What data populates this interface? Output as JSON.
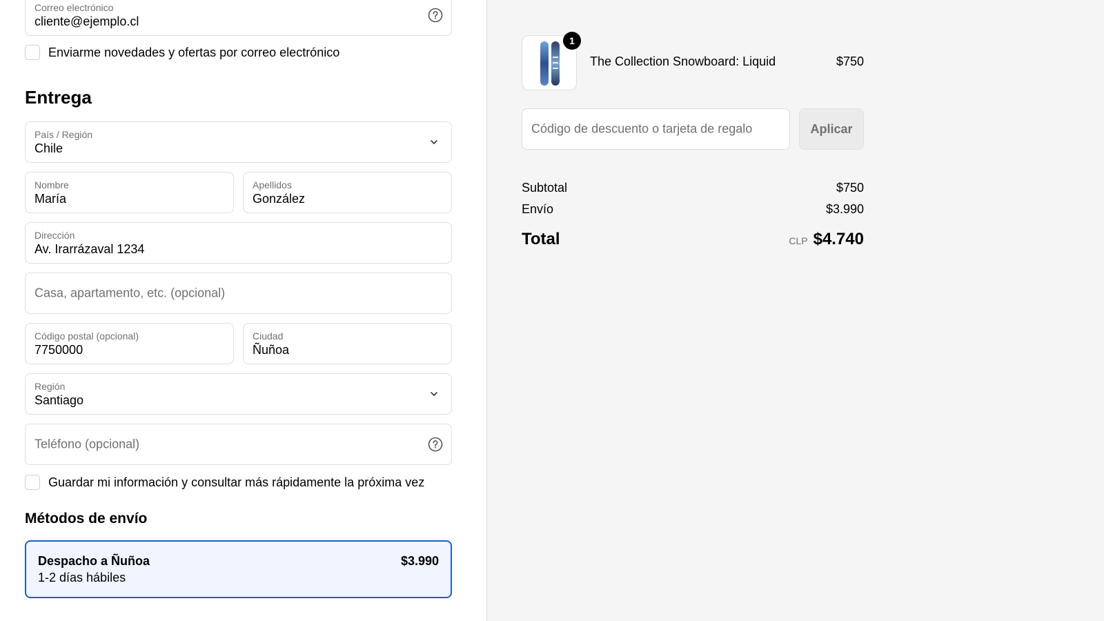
{
  "contact": {
    "email_label": "Correo electrónico",
    "email_value": "cliente@ejemplo.cl",
    "newsletter_label": "Enviarme novedades y ofertas por correo electrónico"
  },
  "delivery": {
    "heading": "Entrega",
    "country_label": "País / Región",
    "country_value": "Chile",
    "first_name_label": "Nombre",
    "first_name_value": "María",
    "last_name_label": "Apellidos",
    "last_name_value": "González",
    "address_label": "Dirección",
    "address_value": "Av. Irarrázaval 1234",
    "apartment_placeholder": "Casa, apartamento, etc. (opcional)",
    "postal_label": "Código postal (opcional)",
    "postal_value": "7750000",
    "city_label": "Ciudad",
    "city_value": "Ñuñoa",
    "region_label": "Región",
    "region_value": "Santiago",
    "phone_placeholder": "Teléfono (opcional)",
    "save_info_label": "Guardar mi información y consultar más rápidamente la próxima vez"
  },
  "shipping": {
    "heading": "Métodos de envío",
    "option_name": "Despacho a Ñuñoa",
    "option_eta": "1-2 días hábiles",
    "option_price": "$3.990",
    "selected_border_color": "#1a5fc8"
  },
  "summary": {
    "item": {
      "quantity_badge": "1",
      "name": "The Collection Snowboard: Liquid",
      "price": "$750",
      "icon": "snowboard-image"
    },
    "discount_placeholder": "Código de descuento o tarjeta de regalo",
    "apply_label": "Aplicar",
    "subtotal_label": "Subtotal",
    "subtotal_value": "$750",
    "shipping_label": "Envío",
    "shipping_value": "$3.990",
    "total_label": "Total",
    "currency": "CLP",
    "total_value": "$4.740"
  }
}
